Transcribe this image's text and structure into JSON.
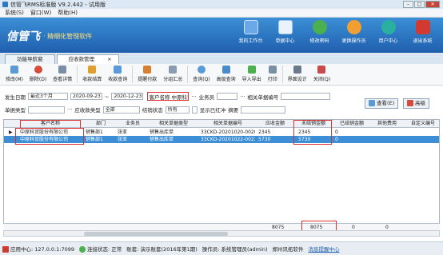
{
  "window": {
    "title": "信管飞RMS标准版 V9.2.442 - 试用版"
  },
  "menu": [
    "系统(S)",
    "窗口(W)",
    "帮助(H)"
  ],
  "banner": {
    "logo": "信管飞",
    "tagline": "· 精细化管理软件"
  },
  "topnav": [
    {
      "label": "我的工作台",
      "color": "#6aa8e8"
    },
    {
      "label": "单据中心",
      "color": "#5b9bd8"
    },
    {
      "label": "修改密码",
      "color": "#4caf50"
    },
    {
      "label": "更换操作员",
      "color": "#f0a030"
    },
    {
      "label": "用户中心",
      "color": "#2ab0a0"
    },
    {
      "label": "退出系统",
      "color": "#d03a30"
    }
  ],
  "tabs": {
    "nav": "功能导航窗",
    "active": "应收款管理",
    "close": "×"
  },
  "toolbar": [
    {
      "label": "修改(M)",
      "color": "#5a9ad8"
    },
    {
      "label": "删除(D)",
      "color": "#d84a3a"
    },
    {
      "label": "查看详情",
      "color": "#7a8ea4"
    },
    {
      "label": "收款结算",
      "color": "#e0a030"
    },
    {
      "label": "收款查询",
      "color": "#5a9ad8"
    },
    {
      "label": "提醒付款",
      "color": "#d88030"
    },
    {
      "label": "分组汇总",
      "color": "#8a9cb0"
    },
    {
      "label": "查询(Q)",
      "color": "#5a9ad8"
    },
    {
      "label": "高级查询",
      "color": "#4a8ac8"
    },
    {
      "label": "导入导出",
      "color": "#4caf50"
    },
    {
      "label": "打印",
      "color": "#7a8ea4"
    },
    {
      "label": "界面设计",
      "color": "#6a7a8c"
    },
    {
      "label": "关闭(Q)",
      "color": "#c84a4a"
    }
  ],
  "filters": {
    "date_label": "发生日期",
    "date_range": "最近3个月",
    "date_from": "2020-09-23",
    "date_to": "2020-12-23",
    "date_sep": "~",
    "customer_label": "客户名称",
    "customer_value": "中原科贸股份有限公司",
    "clerk_label": "业务员",
    "related_no_label": "相关单据编号",
    "doc_type_label": "单据类型",
    "ar_type_label": "应收款类型",
    "ar_type_value": "全部",
    "settle_label": "结销状态",
    "settle_value": "所有",
    "show_red_label": "显示已红冲",
    "summary_label": "摘要",
    "ellipsis": "···",
    "query_button": "查看(E)",
    "filter_button": "高级"
  },
  "table": {
    "columns": [
      "客户名称",
      "部门",
      "业务员",
      "相关单据类型",
      "相关单据编号",
      "应收金额",
      "未结销金额",
      "已结销金额",
      "其他费用",
      "自定义编号"
    ],
    "rows": [
      [
        "中原科贸股份有限公司",
        "销售部1",
        "张亚",
        "销售出库单",
        "33CKD-20201020-0020",
        "2345",
        "2345",
        "0",
        "",
        ""
      ],
      [
        "中原科贸股份有限公司",
        "销售部1",
        "张亚",
        "销售出库单",
        "33CKD-20201022-0022",
        "5730",
        "5730",
        "0",
        "",
        ""
      ]
    ],
    "totals": {
      "receivable": "8075",
      "unsettled": "8075",
      "settled": "0",
      "other": "0"
    }
  },
  "status": {
    "app_center": "应用中心: 127.0.0.1:7099",
    "connection": "连接状态: 正常",
    "account": "账套: 演示账套(2016年第1期)",
    "operator": "操作员: 系统管理员(admin)",
    "company": "郑州讯拓软件",
    "message": "消息提醒中心"
  }
}
